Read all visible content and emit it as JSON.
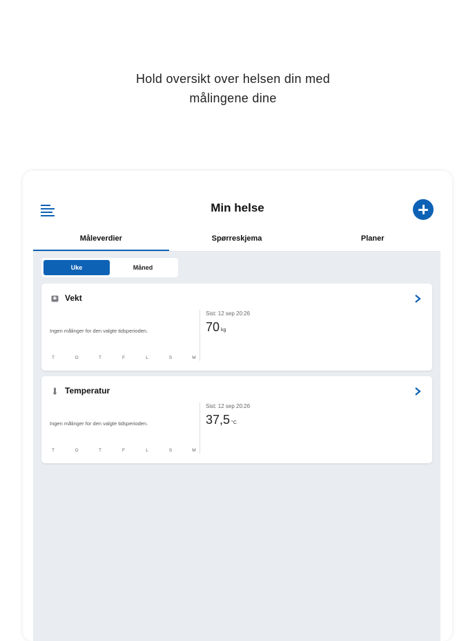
{
  "headline": {
    "line1": "Hold oversikt over helsen din med",
    "line2": "målingene dine"
  },
  "app": {
    "title": "Min helse"
  },
  "tabs": [
    {
      "label": "Måleverdier",
      "active": true
    },
    {
      "label": "Spørreskjema",
      "active": false
    },
    {
      "label": "Planer",
      "active": false
    }
  ],
  "period_toggle": {
    "options": [
      "Uke",
      "Måned"
    ],
    "selected": "Uke"
  },
  "cards": [
    {
      "title": "Vekt",
      "icon": "scale-icon",
      "no_data": "Ingen målinger for den valgte tidsperioden.",
      "days": [
        "T",
        "O",
        "T",
        "F",
        "L",
        "S",
        "M"
      ],
      "last_label": "Sist: 12 sep 20:26",
      "value": "70",
      "unit": "kg"
    },
    {
      "title": "Temperatur",
      "icon": "thermometer-icon",
      "no_data": "Ingen målinger for den valgte tidsperioden.",
      "days": [
        "T",
        "O",
        "T",
        "F",
        "L",
        "S",
        "M"
      ],
      "last_label": "Sist: 12 sep 20:26",
      "value": "37,5",
      "unit": "°C"
    }
  ],
  "colors": {
    "accent": "#0d62b5",
    "background": "#e9ecf0"
  }
}
